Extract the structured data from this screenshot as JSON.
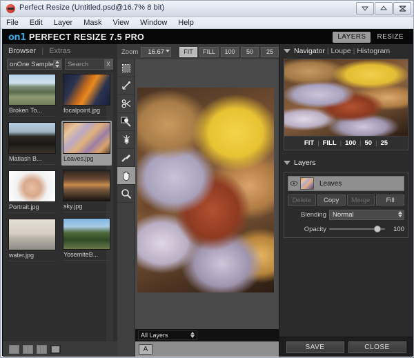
{
  "window": {
    "title": "Perfect Resize (Untitled.psd@16.7% 8 bit)",
    "icon": "app-icon",
    "controls": {
      "minimize": "minimize-icon",
      "maximize": "maximize-icon",
      "close": "close-icon"
    }
  },
  "menubar": {
    "items": [
      "File",
      "Edit",
      "Layer",
      "Mask",
      "View",
      "Window",
      "Help"
    ]
  },
  "brand": {
    "logo": "on1",
    "product": "PERFECT RESIZE 7.5 PRO",
    "mode_tabs": [
      {
        "label": "LAYERS",
        "active": true
      },
      {
        "label": "RESIZE",
        "active": false
      }
    ]
  },
  "browser": {
    "tabs": [
      {
        "label": "Browser",
        "active": true
      },
      {
        "label": "Extras",
        "active": false
      }
    ],
    "source_select": {
      "value": "onOne Samples"
    },
    "search": {
      "value": "",
      "placeholder": "Search",
      "clear_label": "X"
    },
    "items": [
      {
        "name": "Broken To...",
        "selected": false,
        "column": 0
      },
      {
        "name": "Matiash B...",
        "selected": false,
        "column": 0
      },
      {
        "name": "Portrait.jpg",
        "selected": false,
        "column": 0
      },
      {
        "name": "water.jpg",
        "selected": false,
        "column": 0
      },
      {
        "name": "focalpoint.jpg",
        "selected": false,
        "column": 1
      },
      {
        "name": "Leaves.jpg",
        "selected": true,
        "column": 1
      },
      {
        "name": "sky.jpg",
        "selected": false,
        "column": 1
      },
      {
        "name": "YosemiteB...",
        "selected": false,
        "column": 1
      }
    ],
    "view_modes": [
      "single-pane-icon",
      "two-pane-icon",
      "three-pane-icon",
      "list-view-icon"
    ]
  },
  "canvas": {
    "zoom_label": "Zoom",
    "zoom_value": "16.67",
    "zoom_presets": [
      {
        "label": "FIT",
        "active": true
      },
      {
        "label": "FILL",
        "active": false
      },
      {
        "label": "100",
        "active": false
      },
      {
        "label": "50",
        "active": false
      },
      {
        "label": "25",
        "active": false
      }
    ],
    "tools": [
      {
        "name": "crop-tool-icon",
        "active": false
      },
      {
        "name": "pen-tool-icon",
        "active": false
      },
      {
        "name": "scissors-tool-icon",
        "active": false
      },
      {
        "name": "masking-brush-icon",
        "active": false
      },
      {
        "name": "perfect-brush-icon",
        "active": false
      },
      {
        "name": "retouch-brush-icon",
        "active": false
      },
      {
        "name": "hand-tool-icon",
        "active": true
      },
      {
        "name": "zoom-tool-icon",
        "active": false
      }
    ],
    "layer_scope": "All Layers",
    "status_button": "A"
  },
  "navigator": {
    "title": "Navigator",
    "alt_views": [
      "Loupe",
      "Histogram"
    ],
    "presets": [
      "FIT",
      "FILL",
      "100",
      "50",
      "25"
    ]
  },
  "layers": {
    "title": "Layers",
    "rows": [
      {
        "name": "Leaves",
        "visible": true
      }
    ],
    "buttons": [
      {
        "label": "Delete",
        "enabled": false
      },
      {
        "label": "Copy",
        "enabled": true
      },
      {
        "label": "Merge",
        "enabled": false
      },
      {
        "label": "Fill",
        "enabled": true
      }
    ],
    "blending_label": "Blending",
    "blending_value": "Normal",
    "opacity_label": "Opacity",
    "opacity_value": "100"
  },
  "footer": {
    "save_label": "SAVE",
    "close_label": "CLOSE"
  },
  "colors": {
    "accent_blue": "#3ea2d8",
    "panel_bg": "#2e2e2e",
    "canvas_bg": "#4a4a4a",
    "highlight": "#9b9b9b"
  }
}
